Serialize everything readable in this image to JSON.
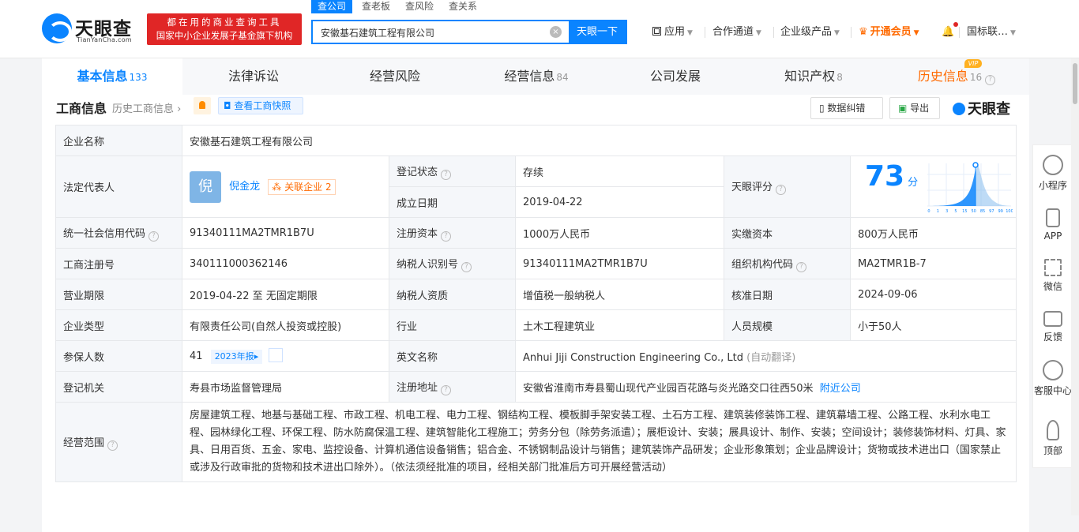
{
  "header": {
    "logo_text": "天眼查",
    "logo_sub": "TianYanCha.com",
    "slogan_line1": "都在用的商业查询工具",
    "slogan_line2": "国家中小企业发展子基金旗下机构",
    "search_tabs": [
      "查公司",
      "查老板",
      "查风险",
      "查关系"
    ],
    "search_value": "安徽基石建筑工程有限公司",
    "search_button": "天眼一下",
    "nav": [
      "应用",
      "合作通道",
      "企业级产品",
      "开通会员",
      "国标联…"
    ]
  },
  "tabs": [
    {
      "label": "基本信息",
      "count": "133"
    },
    {
      "label": "法律诉讼",
      "count": ""
    },
    {
      "label": "经营风险",
      "count": ""
    },
    {
      "label": "经营信息",
      "count": "84"
    },
    {
      "label": "公司发展",
      "count": ""
    },
    {
      "label": "知识产权",
      "count": "8"
    },
    {
      "label": "历史信息",
      "count": "16"
    }
  ],
  "vip_tag": "VIP",
  "section": {
    "title": "工商信息",
    "history_link": "历史工商信息",
    "snapshot": "查看工商快照",
    "feedback": "数据纠错",
    "export": "导出",
    "brand": "天眼查"
  },
  "info": {
    "company_name_label": "企业名称",
    "company_name": "安徽基石建筑工程有限公司",
    "legal_rep_label": "法定代表人",
    "legal_rep_avatar": "倪",
    "legal_rep": "倪金龙",
    "related_label": "关联企业",
    "related_count": "2",
    "reg_status_label": "登记状态",
    "reg_status": "存续",
    "est_date_label": "成立日期",
    "est_date": "2019-04-22",
    "score_label": "天眼评分",
    "score": "73",
    "score_unit": "分",
    "credit_code_label": "统一社会信用代码",
    "credit_code": "91340111MA2TMR1B7U",
    "reg_capital_label": "注册资本",
    "reg_capital": "1000万人民币",
    "paid_capital_label": "实缴资本",
    "paid_capital": "800万人民币",
    "reg_no_label": "工商注册号",
    "reg_no": "340111000362146",
    "tax_id_label": "纳税人识别号",
    "tax_id": "91340111MA2TMR1B7U",
    "org_code_label": "组织机构代码",
    "org_code": "MA2TMR1B-7",
    "term_label": "营业期限",
    "term": "2019-04-22 至 无固定期限",
    "tax_qual_label": "纳税人资质",
    "tax_qual": "增值税一般纳税人",
    "approve_date_label": "核准日期",
    "approve_date": "2024-09-06",
    "type_label": "企业类型",
    "type": "有限责任公司(自然人投资或控股)",
    "industry_label": "行业",
    "industry": "土木工程建筑业",
    "staff_label": "人员规模",
    "staff": "小于50人",
    "insured_label": "参保人数",
    "insured": "41",
    "insured_year": "2023年报",
    "en_name_label": "英文名称",
    "en_name": "Anhui Jiji Construction Engineering Co., Ltd",
    "en_name_note": "(自动翻译)",
    "authority_label": "登记机关",
    "authority": "寿县市场监督管理局",
    "address_label": "注册地址",
    "address": "安徽省淮南市寿县蜀山现代产业园百花路与炎光路交口往西50米",
    "nearby": "附近公司",
    "scope_label": "经营范围",
    "scope": "房屋建筑工程、地基与基础工程、市政工程、机电工程、电力工程、钢结构工程、模板脚手架安装工程、土石方工程、建筑装修装饰工程、建筑幕墙工程、公路工程、水利水电工程、园林绿化工程、环保工程、防水防腐保温工程、建筑智能化工程施工；劳务分包（除劳务派遣）；展柜设计、安装；展具设计、制作、安装；空间设计；装修装饰材料、灯具、家具、日用百货、五金、家电、监控设备、计算机通信设备销售；铝合金、不锈钢制品设计与销售；建筑装饰产品研发；企业形象策划；企业品牌设计；货物或技术进出口（国家禁止或涉及行政审批的货物和技术进出口除外）。（依法须经批准的项目，经相关部门批准后方可开展经营活动）"
  },
  "score_chart": {
    "ticks": [
      "0",
      "1",
      "3",
      "5",
      "15",
      "50",
      "85",
      "97",
      "99",
      "100"
    ]
  },
  "side": [
    "小程序",
    "APP",
    "微信",
    "反馈",
    "客服中心",
    "顶部"
  ]
}
